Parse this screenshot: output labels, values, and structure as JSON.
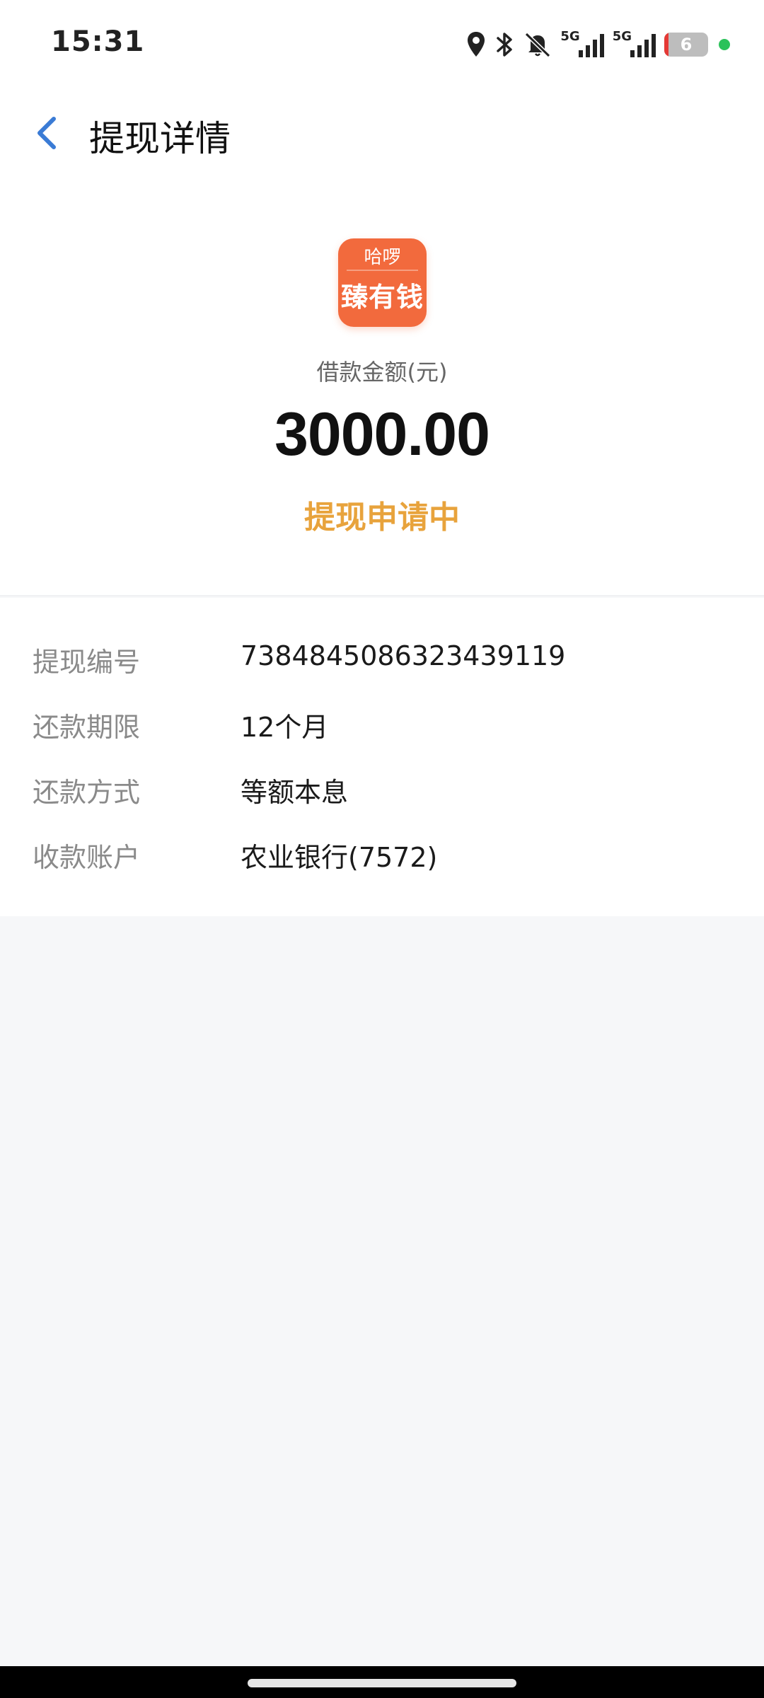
{
  "status_bar": {
    "time": "15:31",
    "network_1": "5G",
    "network_2": "5G",
    "battery_level": "6",
    "icons": [
      "location-icon",
      "bluetooth-icon",
      "mute-icon",
      "signal-icon",
      "signal-icon",
      "battery-icon"
    ]
  },
  "header": {
    "title": "提现详情",
    "back_icon": "chevron-left-icon"
  },
  "summary": {
    "logo_top": "哈啰",
    "logo_main": "臻有钱",
    "amount_label": "借款金额(元)",
    "amount_value": "3000.00",
    "status": "提现申请中"
  },
  "details": [
    {
      "label": "提现编号",
      "value": "7384845086323439119"
    },
    {
      "label": "还款期限",
      "value": "12个月"
    },
    {
      "label": "还款方式",
      "value": "等额本息"
    },
    {
      "label": "收款账户",
      "value": "农业银行(7572)"
    }
  ],
  "colors": {
    "accent_orange": "#f26a3d",
    "status_yellow": "#e8a33c",
    "back_blue": "#3a7bd5",
    "background": "#f6f7f9"
  }
}
